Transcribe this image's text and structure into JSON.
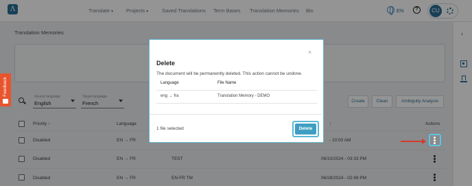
{
  "nav": {
    "logo": "Λ",
    "items": [
      {
        "label": "Translate",
        "chevron": true
      },
      {
        "label": "Projects",
        "chevron": true
      },
      {
        "label": "Saved Translations",
        "chevron": false
      },
      {
        "label": "Term Bases",
        "chevron": false
      },
      {
        "label": "Translation Memories",
        "chevron": false
      },
      {
        "label": "Bin",
        "chevron": false
      }
    ],
    "language": "EN",
    "avatar_initials": "CU"
  },
  "feedback": {
    "label": "Feedback"
  },
  "page": {
    "title": "Translation Memories",
    "source_language": {
      "label": "Source language",
      "value": "English"
    },
    "target_language": {
      "label": "Target language",
      "value": "French"
    },
    "buttons": {
      "create": "Create",
      "clean": "Clean",
      "ambiguity": "Ambiguity Analysis"
    }
  },
  "table": {
    "headers": {
      "priority": "Priority",
      "sort_arrow": "↑",
      "language": "Language",
      "date_arrow": "↑",
      "actions": "Actions"
    },
    "rows": [
      {
        "priority": "Disabled",
        "src": "EN",
        "tgt": "FR",
        "name": "",
        "date": "- 10:00 AM"
      },
      {
        "priority": "Disabled",
        "src": "EN",
        "tgt": "FR",
        "name": "TEST",
        "date": "06/10/2024 - 03:33 PM"
      },
      {
        "priority": "Disabled",
        "src": "EN",
        "tgt": "FR",
        "name": "EN-FR TM",
        "date": "06/28/2024 - 02:49 PM"
      }
    ]
  },
  "modal": {
    "close": "×",
    "title": "Delete",
    "message": "The document will be permanently deleted. This action cannot be undone.",
    "col_language": "Language",
    "col_filename": "File Name",
    "row": {
      "src": "eng",
      "tgt": "fra",
      "filename": "Translation Memory - DEMO"
    },
    "files_selected": "1 file selected",
    "delete_label": "Delete"
  },
  "colors": {
    "accent": "#2a6f97",
    "delete_button": "#3f9fc2",
    "highlight": "#59b8d4",
    "arrow": "#d23a2f",
    "feedback": "#e8542d"
  }
}
